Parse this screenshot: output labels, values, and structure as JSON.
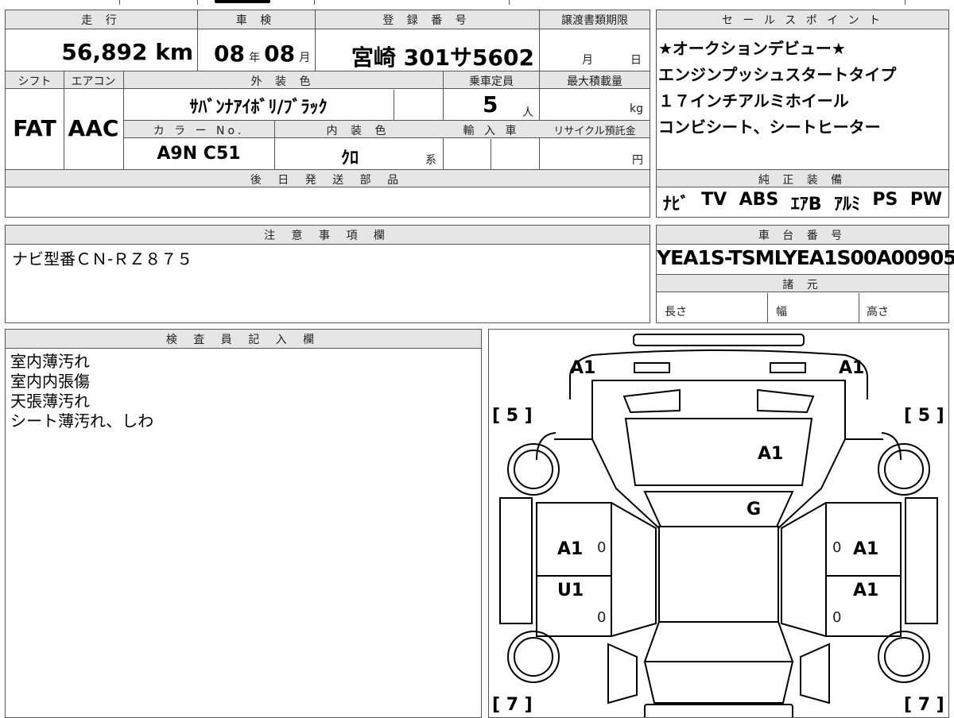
{
  "top_table": {
    "mileage": {
      "label": "走 行",
      "value": "56,892 km"
    },
    "inspection": {
      "label": "車 検",
      "year": "08",
      "year_unit": "年",
      "month": "08",
      "month_unit": "月"
    },
    "registration": {
      "label": "登 録 番 号",
      "value": "宮崎 301サ5602"
    },
    "transfer_deadline": {
      "label": "譲渡書類期限",
      "month_unit": "月",
      "day_unit": "日"
    },
    "shift": {
      "label": "シフト",
      "value": "FAT"
    },
    "aircon": {
      "label": "エアコン",
      "value": "AAC"
    },
    "exterior_color": {
      "label": "外 装 色",
      "value": "ｻﾊﾞﾝﾅｱｲﾎﾞﾘ/ﾌﾞﾗｯｸ"
    },
    "capacity": {
      "label": "乗車定員",
      "value": "5",
      "unit": "人"
    },
    "max_load": {
      "label": "最大積載量",
      "unit": "kg"
    },
    "color_no": {
      "label": "カ ラ ー No.",
      "value": "A9N C51"
    },
    "interior_color": {
      "label": "内 装 色",
      "value": "ｸﾛ",
      "unit": "系"
    },
    "import": {
      "label": "輸 入 車"
    },
    "recycle": {
      "label": "リサイクル預託金",
      "unit": "円"
    },
    "later_parts": {
      "label": "後 日 発 送 部 品"
    }
  },
  "sales_points": {
    "label": "セ ー ル ス ポ イ ン ト",
    "lines": [
      "★オークションデビュー★",
      "エンジンプッシュスタートタイプ",
      "１７インチアルミホイール",
      "コンビシート、シートヒーター"
    ]
  },
  "genuine_equipment": {
    "label": "純 正 装 備",
    "items": [
      "ﾅﾋﾞ",
      "TV",
      "ABS",
      "ｴｱB",
      "ｱﾙﾐ",
      "PS",
      "PW"
    ]
  },
  "notes": {
    "label": "注 意 事 項 欄",
    "text": "ナビ型番ＣＮ-ＲＺ８７５"
  },
  "chassis": {
    "label": "車 台 番 号",
    "value": "YEA1S-TSMLYEA1S00A00905",
    "spec_label": "諸 元",
    "length_label": "長さ",
    "width_label": "幅",
    "height_label": "高さ"
  },
  "inspector": {
    "label": "検 査 員 記 入 欄",
    "lines": [
      "室内薄汚れ",
      "室内内張傷",
      "天張薄汚れ",
      "シート薄汚れ、しわ"
    ]
  },
  "diagram": {
    "marks": {
      "front_left": "A1",
      "front_right": "A1",
      "tire_fl": "[ 5 ]",
      "tire_fr": "[ 5 ]",
      "tire_rl": "[ 7 ]",
      "tire_rr": "[ 7 ]",
      "hood": "A1",
      "windshield": "G",
      "door_fl": "A1",
      "door_rl": "U1",
      "door_fr": "A1",
      "door_rr": "A1",
      "zero_1": "0",
      "zero_2": "0",
      "zero_3": "0",
      "zero_4": "0"
    }
  }
}
